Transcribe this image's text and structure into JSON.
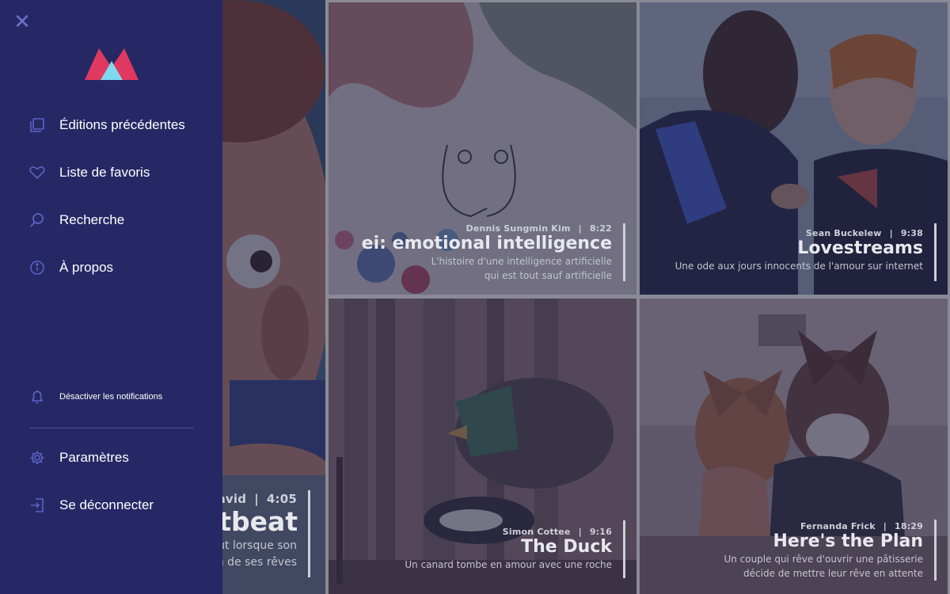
{
  "colors": {
    "sidebar_bg": "#262865",
    "icon": "#5b63c4",
    "logo_pink": "#e0385f",
    "logo_blue": "#7fd7f0"
  },
  "sidebar": {
    "close_label": "✕",
    "nav": [
      {
        "label": "Éditions précédentes",
        "icon": "layers-icon"
      },
      {
        "label": "Liste de favoris",
        "icon": "heart-icon"
      },
      {
        "label": "Recherche",
        "icon": "search-icon"
      },
      {
        "label": "À propos",
        "icon": "info-icon"
      }
    ],
    "notifications_label": "Désactiver les notifications",
    "settings_label": "Paramètres",
    "logout_label": "Se déconnecter"
  },
  "films": [
    {
      "author": "David",
      "author_display": "avid",
      "duration": "4:05",
      "title": "Heartbeat",
      "title_display": "rtbeat",
      "desc": [
        "ut lorsque son",
        "on de ses rêves"
      ]
    },
    {
      "author": "Dennis Sungmin Kim",
      "duration": "8:22",
      "title": "ei: emotional intelligence",
      "desc": [
        "L'histoire d'une intelligence artificielle",
        "qui est tout sauf artificielle"
      ]
    },
    {
      "author": "Sean Buckelew",
      "duration": "9:38",
      "title": "Lovestreams",
      "desc": [
        "Une ode aux jours innocents de l'amour sur internet"
      ]
    },
    {
      "author": "Simon Cottee",
      "duration": "9:16",
      "title": "The Duck",
      "desc": [
        "Un canard tombe en amour avec une roche"
      ]
    },
    {
      "author": "Fernanda Frick",
      "duration": "18:29",
      "title": "Here's the Plan",
      "desc": [
        "Un couple qui rêve d'ouvrir une pâtisserie",
        "décide de mettre leur rêve en attente"
      ]
    }
  ]
}
